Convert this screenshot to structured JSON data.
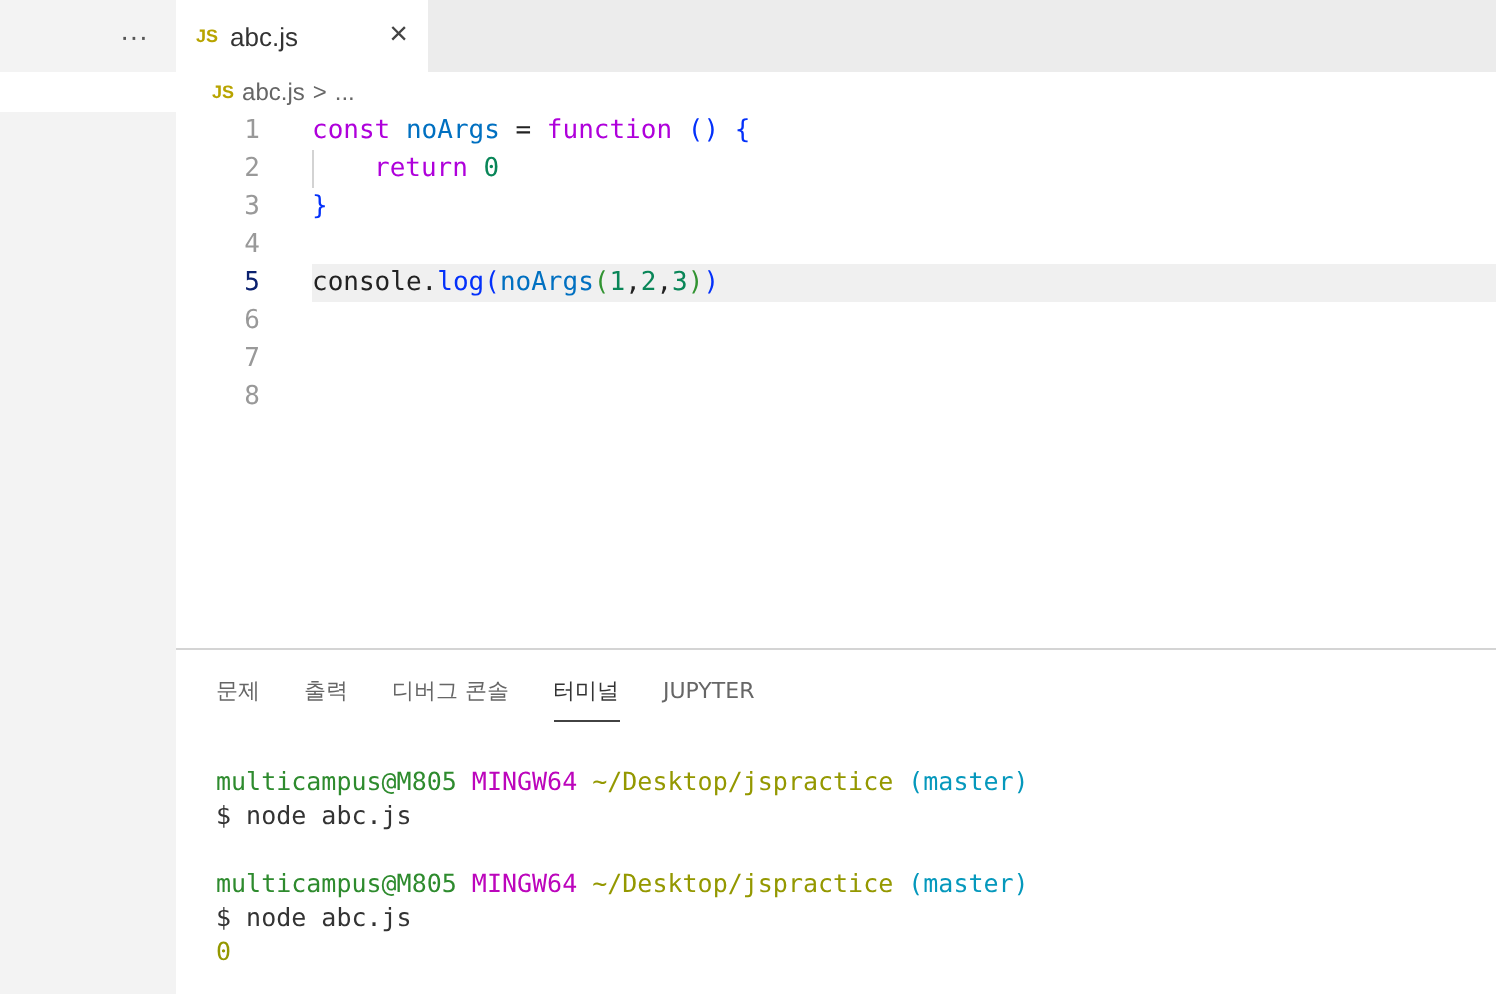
{
  "sidebar": {
    "more": "···"
  },
  "tabs": [
    {
      "icon": "JS",
      "label": "abc.js",
      "close": "×",
      "selected": true
    }
  ],
  "breadcrumb": {
    "icon": "JS",
    "file": "abc.js",
    "separator": ">",
    "rest": "..."
  },
  "editor": {
    "lines": [
      {
        "number": "1",
        "current": false,
        "tokens": [
          {
            "text": "const",
            "kind": "keyword"
          },
          {
            "text": " noArgs",
            "kind": "variable"
          },
          {
            "text": " = ",
            "kind": "plain"
          },
          {
            "text": "function",
            "kind": "keyword"
          },
          {
            "text": " ()",
            "kind": "bracket"
          },
          {
            "text": " {",
            "kind": "bracket"
          }
        ]
      },
      {
        "number": "2",
        "current": false,
        "indent": true,
        "tokens": [
          {
            "text": "return",
            "kind": "keyword"
          },
          {
            "text": " 0",
            "kind": "number"
          }
        ]
      },
      {
        "number": "3",
        "current": false,
        "tokens": [
          {
            "text": "}",
            "kind": "bracket"
          }
        ]
      },
      {
        "number": "4",
        "current": false
      },
      {
        "number": "5",
        "current": true,
        "tokens": [
          {
            "text": "console.",
            "kind": "plain"
          },
          {
            "text": "log",
            "kind": "function"
          },
          {
            "text": "(",
            "kind": "bracket"
          },
          {
            "text": "noArgs",
            "kind": "variable"
          },
          {
            "text": "(",
            "kind": "bracket2"
          },
          {
            "text": "1",
            "kind": "number"
          },
          {
            "text": ",",
            "kind": "plain"
          },
          {
            "text": "2",
            "kind": "number"
          },
          {
            "text": ",",
            "kind": "plain"
          },
          {
            "text": "3",
            "kind": "number"
          },
          {
            "text": ")",
            "kind": "bracket2"
          },
          {
            "text": ")",
            "kind": "bracket"
          }
        ]
      },
      {
        "number": "6",
        "current": false
      },
      {
        "number": "7",
        "current": false
      },
      {
        "number": "8",
        "current": false
      }
    ]
  },
  "panel_tabs": [
    {
      "label": "문제",
      "selected": false
    },
    {
      "label": "출력",
      "selected": false
    },
    {
      "label": "디버그 콘솔",
      "selected": false
    },
    {
      "label": "터미널",
      "selected": true
    },
    {
      "label": "JUPYTER",
      "selected": false
    }
  ],
  "terminal": {
    "sessions": [
      {
        "lines": [
          {
            "segments": [
              {
                "text": "multicampus@M805",
                "kind": "user"
              },
              {
                "text": "MINGW64",
                "kind": "host"
              },
              {
                "text": "~/Desktop/jspractice",
                "kind": "path"
              },
              {
                "text": "(master)",
                "kind": "branch"
              }
            ]
          },
          {
            "segments": [
              {
                "text": "$ node abc.js",
                "kind": "plain"
              }
            ]
          }
        ]
      },
      {
        "lines": [
          {
            "segments": [
              {
                "text": "multicampus@M805",
                "kind": "user"
              },
              {
                "text": "MINGW64",
                "kind": "host"
              },
              {
                "text": "~/Desktop/jspractice",
                "kind": "path"
              },
              {
                "text": "(master)",
                "kind": "branch"
              }
            ]
          },
          {
            "segments": [
              {
                "text": "$ node abc.js",
                "kind": "plain"
              }
            ]
          },
          {
            "segments": [
              {
                "text": "0",
                "kind": "output"
              }
            ]
          }
        ]
      }
    ]
  }
}
